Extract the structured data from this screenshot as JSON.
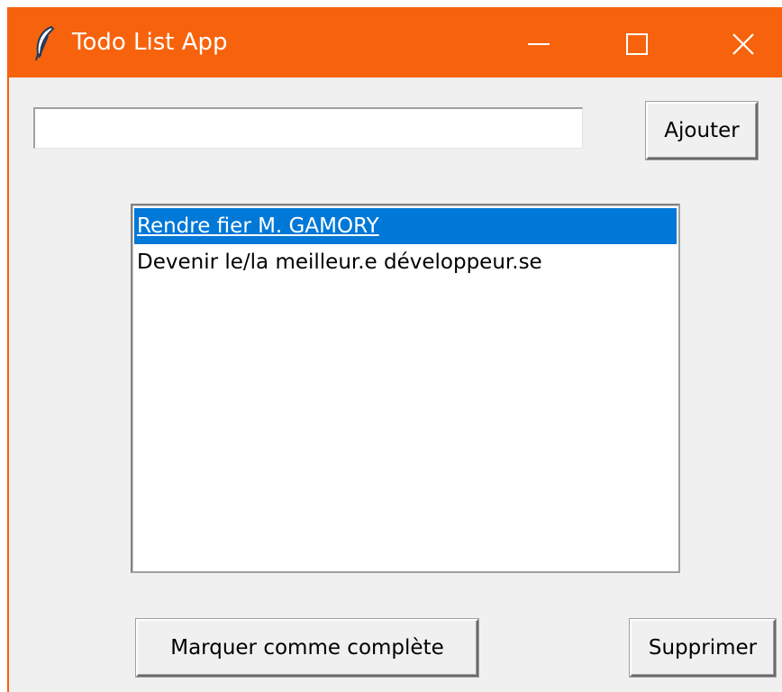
{
  "window": {
    "title": "Todo List App",
    "icon": "feather-icon",
    "controls": [
      "minimize-icon",
      "maximize-icon",
      "close-icon"
    ],
    "accent_color": "#f7630c"
  },
  "entry": {
    "value": ""
  },
  "buttons": {
    "add_label": "Ajouter",
    "complete_label": "Marquer comme complète",
    "delete_label": "Supprimer"
  },
  "tasks": {
    "selected_index": 0,
    "selection_color": "#0078d7",
    "items": [
      {
        "label": "Rendre fier M. GAMORY"
      },
      {
        "label": "Devenir le/la meilleur.e développeur.se"
      }
    ]
  }
}
